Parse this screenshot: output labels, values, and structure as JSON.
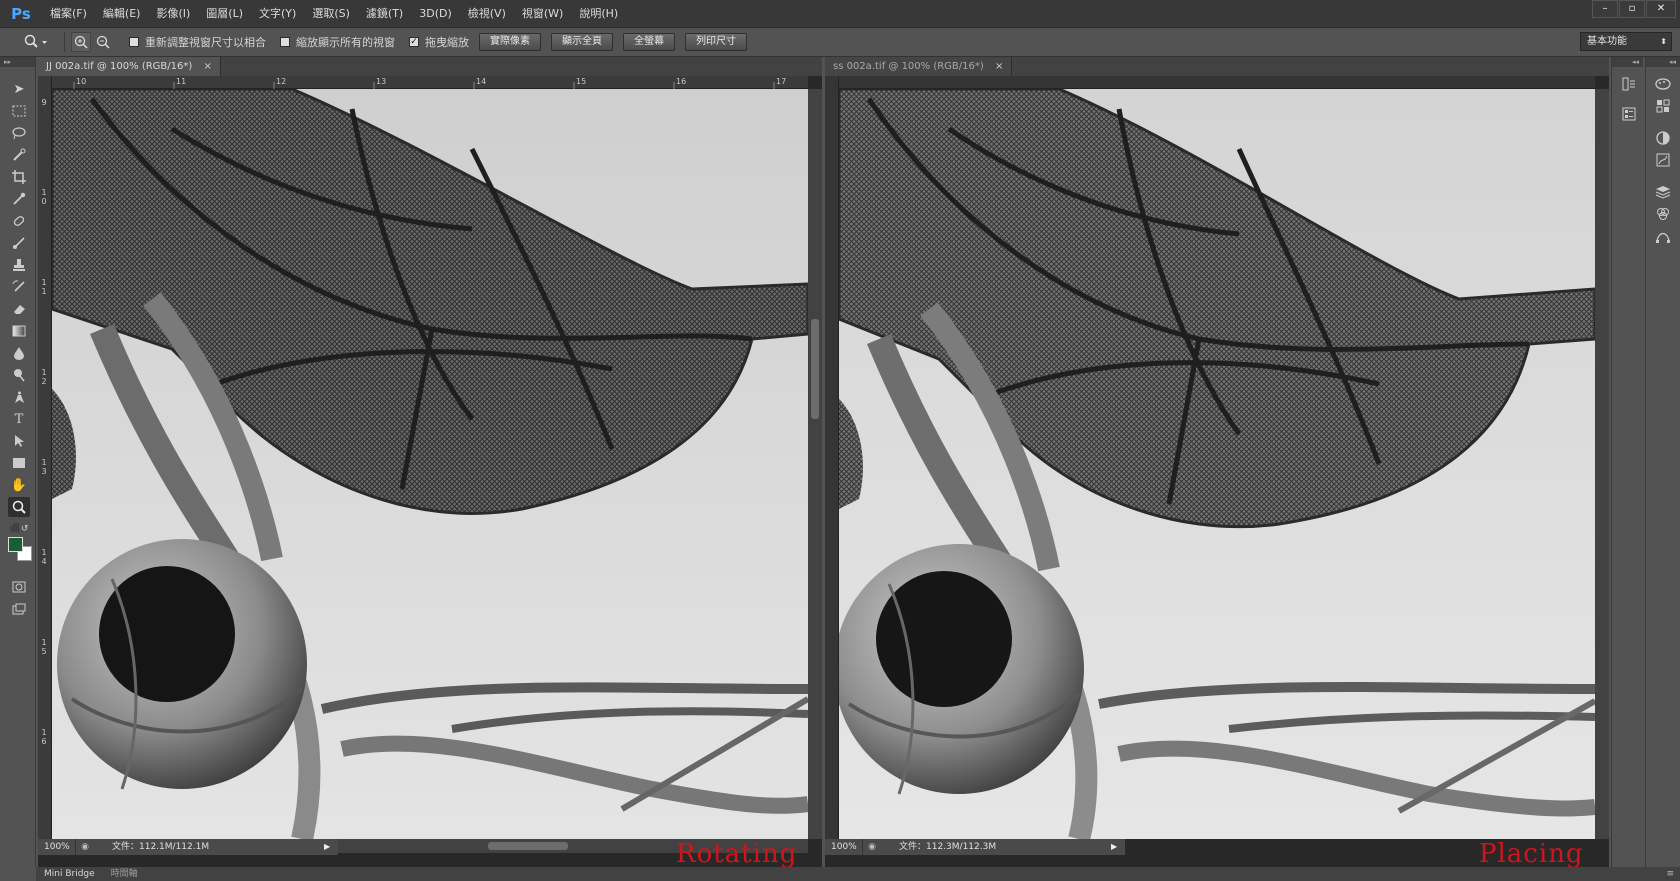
{
  "app": {
    "logo": "Ps",
    "menu": [
      "檔案(F)",
      "編輯(E)",
      "影像(I)",
      "圖層(L)",
      "文字(Y)",
      "選取(S)",
      "濾鏡(T)",
      "3D(D)",
      "檢視(V)",
      "視窗(W)",
      "說明(H)"
    ],
    "window_controls": [
      "–",
      "▫",
      "✕"
    ]
  },
  "options_bar": {
    "tool_icon": "zoom-tool-icon",
    "zoom_in_icon": "zoom-in-icon",
    "zoom_out_icon": "zoom-out-icon",
    "checkbox_resize": {
      "label": "重新調整視窗尺寸以相合",
      "checked": false
    },
    "checkbox_all_windows": {
      "label": "縮放顯示所有的視窗",
      "checked": false
    },
    "checkbox_scrubby": {
      "label": "拖曳縮放",
      "checked": true
    },
    "buttons": [
      "實際像素",
      "顯示全頁",
      "全螢幕",
      "列印尺寸"
    ],
    "workspace": "基本功能"
  },
  "left_document": {
    "tab_title": "JJ 002a.tif @ 100% (RGB/16*)",
    "tab_close": "×",
    "ruler_top": [
      "10",
      "11",
      "12",
      "13",
      "14",
      "15",
      "16",
      "17"
    ],
    "ruler_left": [
      "9",
      "1 0",
      "1 1",
      "1 2",
      "1 3",
      "1 4",
      "1 5",
      "1 6"
    ],
    "zoom": "100%",
    "doc_info": "文件：112.1M/112.1M",
    "label": "Rotating"
  },
  "right_document": {
    "tab_title": "ss 002a.tif @ 100% (RGB/16*)",
    "tab_close": "×",
    "zoom": "100%",
    "doc_info": "文件：112.3M/112.3M",
    "label": "Placing"
  },
  "bottom_panel": {
    "tabs": [
      "Mini Bridge",
      "時間軸"
    ],
    "menu_icon": "≡"
  },
  "colors": {
    "foreground": "#1e5c34",
    "background": "#ffffff",
    "label_red": "#d2141b",
    "ps_blue": "#4aa8ff"
  }
}
